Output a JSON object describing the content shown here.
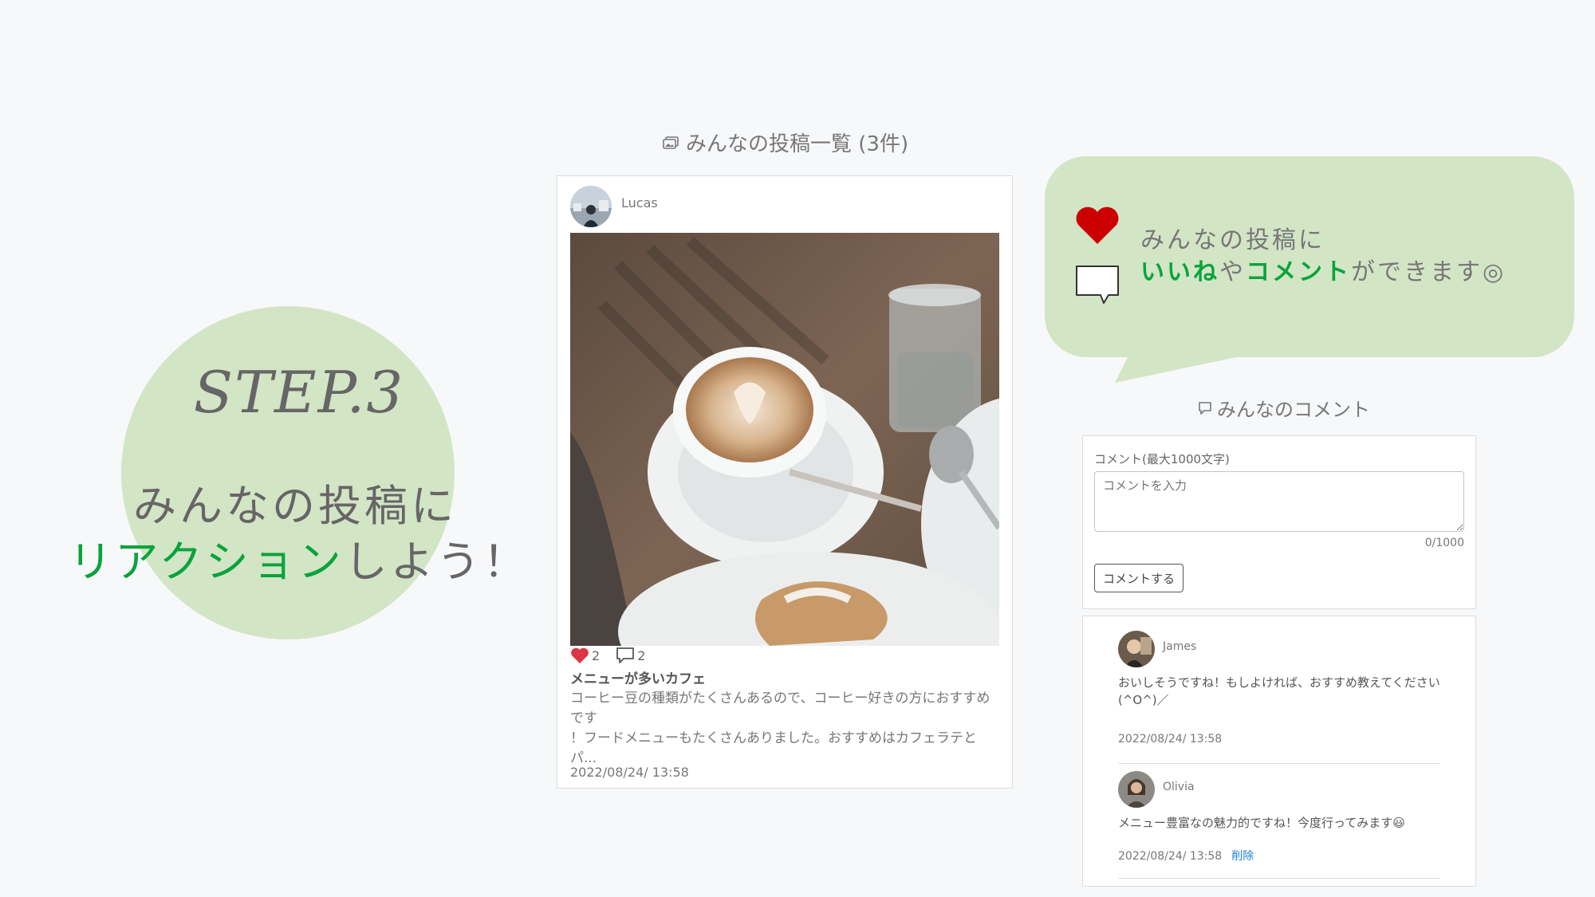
{
  "step": {
    "title": "STEP.3",
    "line1": "みんなの投稿に",
    "line2_green": "リアクション",
    "line2_rest": "しよう！"
  },
  "posts": {
    "heading": "みんなの投稿一覧 (3件)",
    "card": {
      "username": "Lucas",
      "likes": "2",
      "comments": "2",
      "title": "メニューが多いカフェ",
      "body_line1": "コーヒー豆の種類がたくさんあるので、コーヒー好きの方におすすめです",
      "body_line2": "！フードメニューもたくさんありました。おすすめはカフェラテとパ...",
      "date": "2022/08/24/ 13:58"
    }
  },
  "bubble": {
    "line1": "みんなの投稿に",
    "like_word": "いいね",
    "ya": "や",
    "comment_word": "コメント",
    "line2_rest": "ができます◎"
  },
  "comments": {
    "heading": "みんなのコメント",
    "form": {
      "label": "コメント(最大1000文字)",
      "placeholder": "コメントを入力",
      "count": "0/1000",
      "submit": "コメントする"
    },
    "items": [
      {
        "user": "James",
        "text": "おいしそうですね！もしよければ、おすすめ教えてください(^O^)／",
        "date": "2022/08/24/ 13:58"
      },
      {
        "user": "Olivia",
        "text": "メニュー豊富なの魅力的ですね！今度行ってみます😃",
        "date": "2022/08/24/ 13:58",
        "delete": "削除"
      }
    ]
  },
  "colors": {
    "accent_green": "#0aa33c",
    "circle_bg": "#d2e5c5",
    "heart_red": "#dc3545",
    "link_blue": "#1e7de0"
  }
}
